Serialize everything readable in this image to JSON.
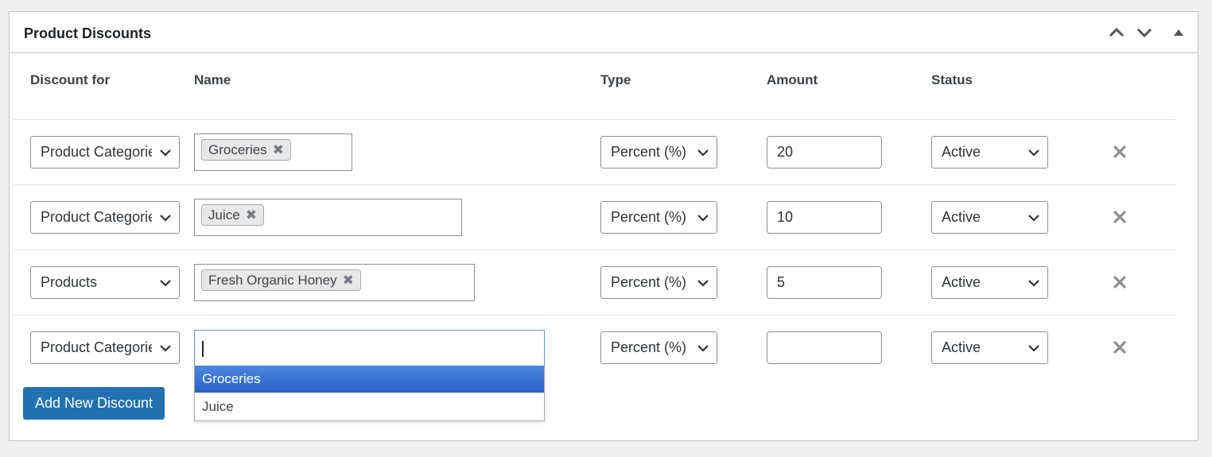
{
  "panel": {
    "title": "Product Discounts",
    "header_icons": [
      "chevron-up-icon",
      "chevron-down-icon",
      "triangle-up-icon"
    ]
  },
  "columns": {
    "discount_for": "Discount for",
    "name": "Name",
    "type": "Type",
    "amount": "Amount",
    "status": "Status"
  },
  "rows": [
    {
      "discount_for": "Product Categories",
      "tags": [
        "Groceries"
      ],
      "type": "Percent (%)",
      "amount": "20",
      "status": "Active"
    },
    {
      "discount_for": "Product Categories",
      "tags": [
        "Juice"
      ],
      "type": "Percent (%)",
      "amount": "10",
      "status": "Active"
    },
    {
      "discount_for": "Products",
      "tags": [
        "Fresh Organic Honey"
      ],
      "type": "Percent (%)",
      "amount": "5",
      "status": "Active"
    },
    {
      "discount_for": "Product Categories",
      "tags": [],
      "type": "Percent (%)",
      "amount": "",
      "status": "Active"
    }
  ],
  "dropdown": {
    "options": [
      "Groceries",
      "Juice"
    ],
    "highlighted": "Groceries"
  },
  "buttons": {
    "add_new": "Add New Discount"
  },
  "colors": {
    "primary": "#2271b1",
    "highlight": "#3875d7",
    "border": "#8c8f94"
  }
}
